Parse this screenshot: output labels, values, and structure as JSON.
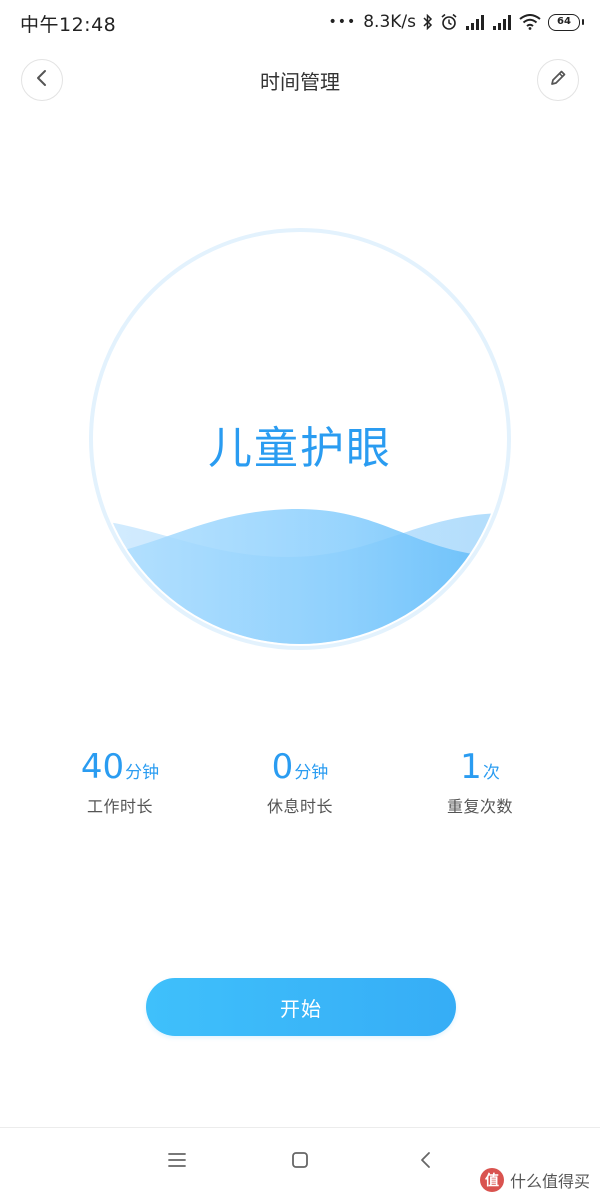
{
  "status_bar": {
    "time": "中午12:48",
    "dots": "•••",
    "network_speed": "8.3K/s",
    "battery_level": "64",
    "icons": [
      "bluetooth-icon",
      "alarm-icon",
      "signal-icon",
      "signal-icon",
      "wifi-icon",
      "battery-icon"
    ]
  },
  "header": {
    "title": "时间管理",
    "back_icon": "chevron-left-icon",
    "edit_icon": "pencil-icon"
  },
  "mode": {
    "title": "儿童护眼"
  },
  "stats": [
    {
      "value": "40",
      "unit": "分钟",
      "label": "工作时长"
    },
    {
      "value": "0",
      "unit": "分钟",
      "label": "休息时长"
    },
    {
      "value": "1",
      "unit": "次",
      "label": "重复次数"
    }
  ],
  "actions": {
    "start_label": "开始"
  },
  "system_nav": {
    "icons": [
      "menu-icon",
      "home-icon",
      "back-icon"
    ]
  },
  "watermark": {
    "logo_text": "值",
    "text": "什么值得买"
  },
  "colors": {
    "accent": "#2a9cf1",
    "button_start": "#3fc0fb",
    "button_end": "#36adf6",
    "circle_border": "#e3f2fd"
  }
}
